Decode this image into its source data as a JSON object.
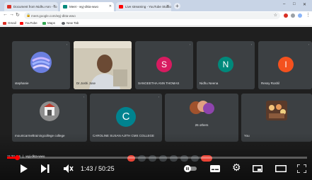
{
  "browser": {
    "tabs": [
      {
        "label": "Document from Nidhu Ann - co",
        "fav_color": "#d93025"
      },
      {
        "label": "Meet - wyj-dkta-wwo",
        "fav_color": "#00897b"
      },
      {
        "label": "Live streaming - YouTube Studio",
        "fav_color": "#ff0000"
      }
    ],
    "new_tab": "+",
    "window_controls": [
      "–",
      "□",
      "✕"
    ],
    "url": "meet.google.com/wyj-dkta-wwo",
    "bookmarks": [
      {
        "label": "Gmail",
        "color": "#d93025"
      },
      {
        "label": "YouTube",
        "color": "#ff0000"
      },
      {
        "label": "Maps",
        "color": "#34a853"
      },
      {
        "label": "New Tab",
        "color": "#5f6368"
      }
    ]
  },
  "meet": {
    "participants": [
      {
        "name": "stephanie",
        "type": "image"
      },
      {
        "name": "Dr.Joshi Jose",
        "type": "video"
      },
      {
        "name": "SANGEETHA ANN THOMAS",
        "type": "letter",
        "letter": "S",
        "color": "#d81b60"
      },
      {
        "name": "Nidhu Neena",
        "type": "letter",
        "letter": "N",
        "color": "#00897b"
      },
      {
        "name": "Ressy Roshil",
        "type": "letter",
        "letter": "I",
        "color": "#f4511e"
      },
      {
        "name": "mountcarmeltrainingcollege college",
        "type": "image"
      },
      {
        "name": "CAROLINE SUSAN AJITH CMS COLLEGE",
        "type": "letter",
        "letter": "C",
        "color": "#00838f"
      },
      {
        "name": "26 others",
        "type": "group"
      },
      {
        "name": "You",
        "type": "image"
      }
    ],
    "bottom": {
      "time": "11:32 AM",
      "meeting_code": "wyj-dkta-wwo"
    }
  },
  "player": {
    "current_time": "1:43",
    "duration": "50:25",
    "time_separator": " / ",
    "progress_fraction": 0.034
  },
  "colors": {
    "accent": "#ff0000",
    "tile": "#3c4043",
    "end_call": "#ea4335"
  }
}
